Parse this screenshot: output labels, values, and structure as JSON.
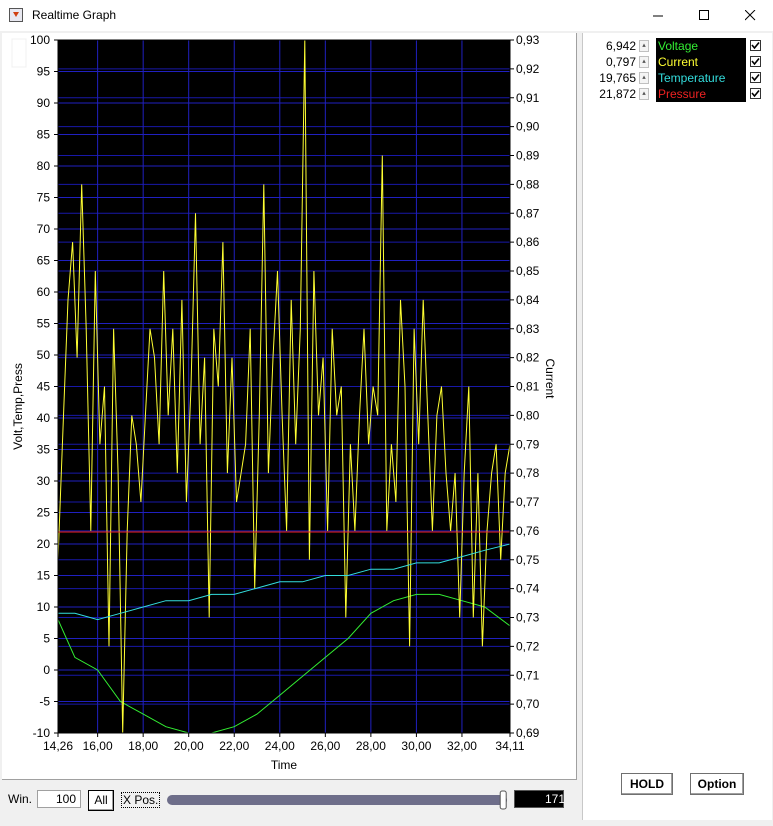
{
  "window": {
    "title": "Realtime Graph"
  },
  "legend": [
    {
      "value": "6,942",
      "label": "Voltage",
      "color": "#33ee33",
      "checked": true
    },
    {
      "value": "0,797",
      "label": "Current",
      "color": "#ffff33",
      "checked": true
    },
    {
      "value": "19,765",
      "label": "Temperature",
      "color": "#33dddd",
      "checked": true
    },
    {
      "value": "21,872",
      "label": "Pressure",
      "color": "#ee2222",
      "checked": true
    }
  ],
  "buttons": {
    "hold": "HOLD",
    "option": "Option"
  },
  "bottombar": {
    "win_label": "Win.",
    "win_value": "100",
    "all_label": "All",
    "xpos_label": "X Pos.",
    "slider_value": "171",
    "slider_fraction": 0.98
  },
  "chart_data": {
    "type": "line",
    "xlabel": "Time",
    "ylabel": "Volt,Temp,Press",
    "y2label": "Current",
    "xlim": [
      14.26,
      34.11
    ],
    "ylim": [
      -10,
      100
    ],
    "y2lim": [
      0.69,
      0.93
    ],
    "x_ticks": [
      "14,26",
      "16,00",
      "18,00",
      "20,00",
      "22,00",
      "24,00",
      "26,00",
      "28,00",
      "30,00",
      "32,00",
      "34,11"
    ],
    "x_tick_values": [
      14.26,
      16,
      18,
      20,
      22,
      24,
      26,
      28,
      30,
      32,
      34.11
    ],
    "y_ticks": [
      "100",
      "95",
      "90",
      "85",
      "80",
      "75",
      "70",
      "65",
      "60",
      "55",
      "50",
      "45",
      "40",
      "35",
      "30",
      "25",
      "20",
      "15",
      "10",
      "5",
      "0",
      "-5",
      "-10"
    ],
    "y2_ticks": [
      "0,93",
      "0,92",
      "0,91",
      "0,90",
      "0,89",
      "0,88",
      "0,87",
      "0,86",
      "0,85",
      "0,84",
      "0,83",
      "0,82",
      "0,81",
      "0,80",
      "0,79",
      "0,78",
      "0,77",
      "0,76",
      "0,75",
      "0,74",
      "0,73",
      "0,72",
      "0,71",
      "0,70",
      "0,69"
    ],
    "background": "#000000",
    "grid": true,
    "series": [
      {
        "name": "Voltage",
        "axis": "left",
        "color": "#33ee33",
        "x": [
          14.26,
          15,
          16,
          17,
          18,
          19,
          20,
          21,
          22,
          23,
          24,
          25,
          26,
          27,
          28,
          29,
          30,
          31,
          32,
          33,
          34.11
        ],
        "y": [
          8,
          2,
          0,
          -5,
          -7,
          -9,
          -10,
          -10,
          -9,
          -7,
          -4,
          -1,
          2,
          5,
          9,
          11,
          12,
          12,
          11,
          10,
          7
        ]
      },
      {
        "name": "Current",
        "axis": "right",
        "color": "#ffff33",
        "x": [
          14.26,
          14.5,
          14.7,
          14.9,
          15.1,
          15.3,
          15.5,
          15.7,
          15.9,
          16.1,
          16.3,
          16.5,
          16.7,
          16.9,
          17.1,
          17.3,
          17.5,
          17.7,
          17.9,
          18.1,
          18.3,
          18.5,
          18.7,
          18.9,
          19.1,
          19.3,
          19.5,
          19.7,
          19.9,
          20.1,
          20.3,
          20.5,
          20.7,
          20.9,
          21.1,
          21.3,
          21.5,
          21.7,
          21.9,
          22.1,
          22.3,
          22.5,
          22.7,
          22.9,
          23.1,
          23.3,
          23.5,
          23.7,
          23.9,
          24.1,
          24.3,
          24.5,
          24.7,
          24.9,
          25.1,
          25.3,
          25.5,
          25.7,
          25.9,
          26.1,
          26.3,
          26.5,
          26.7,
          26.9,
          27.1,
          27.3,
          27.5,
          27.7,
          27.9,
          28.1,
          28.3,
          28.5,
          28.7,
          28.9,
          29.1,
          29.3,
          29.5,
          29.7,
          29.9,
          30.1,
          30.3,
          30.5,
          30.7,
          30.9,
          31.1,
          31.3,
          31.5,
          31.7,
          31.9,
          32.1,
          32.3,
          32.5,
          32.7,
          32.9,
          33.1,
          33.3,
          33.5,
          33.7,
          33.9,
          34.11
        ],
        "y": [
          0.75,
          0.8,
          0.84,
          0.86,
          0.82,
          0.88,
          0.83,
          0.76,
          0.85,
          0.79,
          0.81,
          0.72,
          0.83,
          0.78,
          0.69,
          0.76,
          0.8,
          0.79,
          0.77,
          0.8,
          0.83,
          0.82,
          0.79,
          0.85,
          0.8,
          0.83,
          0.78,
          0.84,
          0.77,
          0.81,
          0.87,
          0.79,
          0.82,
          0.73,
          0.83,
          0.81,
          0.86,
          0.78,
          0.82,
          0.77,
          0.78,
          0.79,
          0.83,
          0.74,
          0.8,
          0.88,
          0.78,
          0.82,
          0.85,
          0.8,
          0.76,
          0.84,
          0.79,
          0.83,
          0.93,
          0.75,
          0.85,
          0.8,
          0.82,
          0.76,
          0.83,
          0.8,
          0.81,
          0.73,
          0.79,
          0.76,
          0.8,
          0.83,
          0.79,
          0.81,
          0.8,
          0.89,
          0.76,
          0.79,
          0.77,
          0.84,
          0.81,
          0.72,
          0.83,
          0.79,
          0.84,
          0.8,
          0.76,
          0.8,
          0.81,
          0.78,
          0.76,
          0.78,
          0.73,
          0.78,
          0.81,
          0.73,
          0.78,
          0.72,
          0.76,
          0.78,
          0.79,
          0.75,
          0.78,
          0.79
        ]
      },
      {
        "name": "Temperature",
        "axis": "left",
        "color": "#33dddd",
        "x": [
          14.26,
          15,
          16,
          17,
          18,
          19,
          20,
          21,
          22,
          23,
          24,
          25,
          26,
          27,
          28,
          29,
          30,
          31,
          32,
          33,
          34.11
        ],
        "y": [
          9,
          9,
          8,
          9,
          10,
          11,
          11,
          12,
          12,
          13,
          14,
          14,
          15,
          15,
          16,
          16,
          17,
          17,
          18,
          19,
          20
        ]
      },
      {
        "name": "Pressure",
        "axis": "left",
        "color": "#ee2222",
        "x": [
          14.26,
          34.11
        ],
        "y": [
          21.9,
          21.9
        ]
      }
    ]
  }
}
